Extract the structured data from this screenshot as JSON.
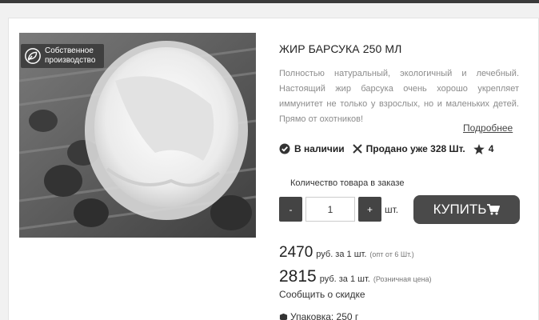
{
  "badge": {
    "text": "Собственное\nпроизводство"
  },
  "product": {
    "title": "ЖИР БАРСУКА 250 МЛ",
    "description": "Полностью натуральный, экологичный и лечебный. Настоящий жир барсука очень хорошо укрепляет иммунитет не только у взрослых, но и маленьких детей. Прямо от охотников!",
    "more_link": "Подробнее"
  },
  "status": {
    "in_stock": "В наличии",
    "sold": "Продано уже 328 Шт.",
    "rating": "4"
  },
  "order": {
    "qty_label": "Количество товара в заказе",
    "minus": "-",
    "plus": "+",
    "qty_value": "1",
    "unit": "шт.",
    "buy_label": "КУПИТЬ"
  },
  "prices": {
    "wholesale_value": "2470",
    "wholesale_unit": "руб. за 1 шт.",
    "wholesale_note": "(опт от 6 Шт.)",
    "retail_value": "2815",
    "retail_unit": "руб. за 1 шт.",
    "retail_note": "(Розничная цена)"
  },
  "discount_link": "Сообщить о скидке",
  "packaging": "Упаковка: 250 г"
}
